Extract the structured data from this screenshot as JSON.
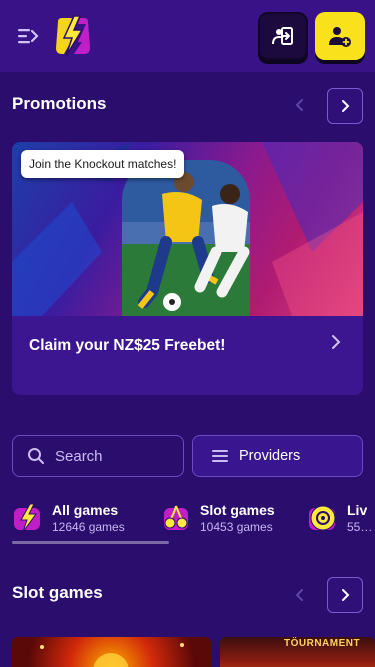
{
  "header": {
    "menu_icon": "menu-expand-icon",
    "logo_icon": "lightning-bolt-logo",
    "login_icon": "user-login-icon",
    "register_icon": "user-plus-icon",
    "colors": {
      "bar": "#3a1287",
      "register_bg": "#f9e11c"
    }
  },
  "promotions": {
    "title": "Promotions",
    "card": {
      "tooltip": "Join the Knockout matches!",
      "caption": "Claim your NZ$25 Freebet!"
    }
  },
  "search": {
    "placeholder": "Search"
  },
  "providers": {
    "label": "Providers"
  },
  "categories": [
    {
      "name": "All games",
      "count": "12646 games",
      "icon": "lightning-icon"
    },
    {
      "name": "Slot games",
      "count": "10453 games",
      "icon": "cherries-icon"
    },
    {
      "name": "Liv",
      "count": "55…",
      "icon": "roulette-icon"
    }
  ],
  "slot_games": {
    "title": "Slot games",
    "tiles": [
      {
        "label": ""
      },
      {
        "label": "TÖURNAMENT"
      }
    ]
  }
}
